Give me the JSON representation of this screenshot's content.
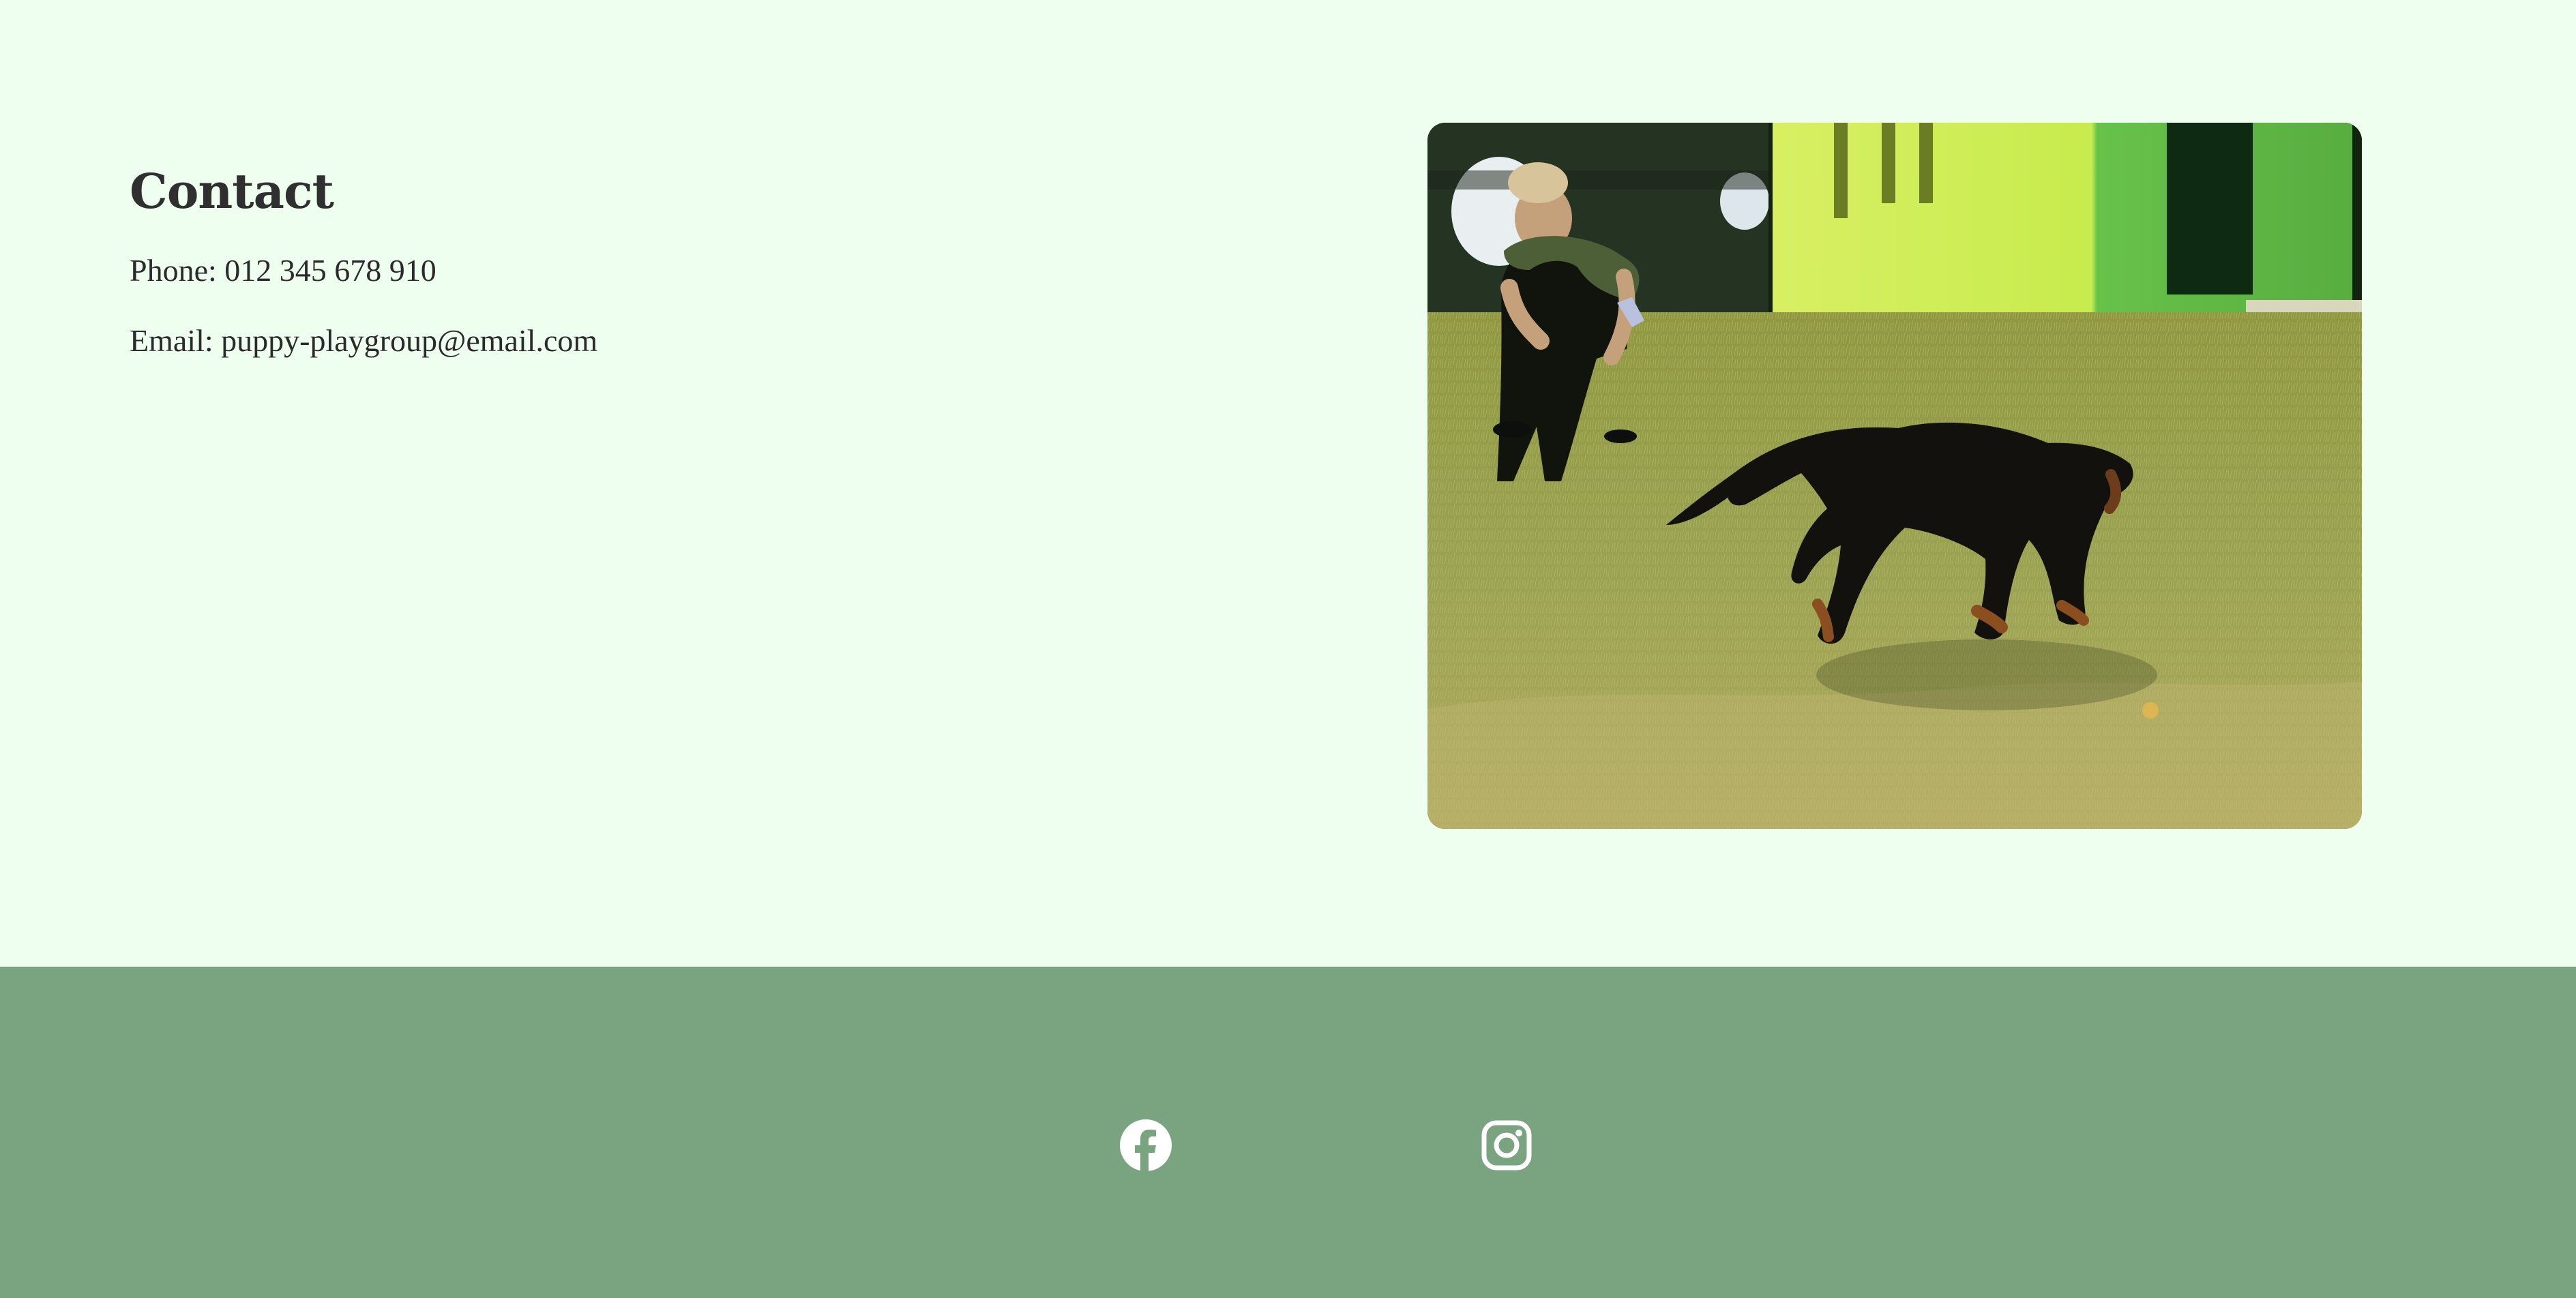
{
  "contact": {
    "heading": "Contact",
    "phone_label": "Phone:",
    "phone_value": "012 345 678 910",
    "email_label": "Email:",
    "email_value": "puppy-playgroup@email.com"
  },
  "photo": {
    "icon": "puppy-running-photo"
  },
  "footer": {
    "social": [
      {
        "icon": "facebook-icon"
      },
      {
        "icon": "instagram-icon"
      }
    ]
  },
  "colors": {
    "page_background": "#efffef",
    "footer_background": "#7aa37f",
    "text": "#2f2f2f",
    "icon": "#ffffff"
  }
}
